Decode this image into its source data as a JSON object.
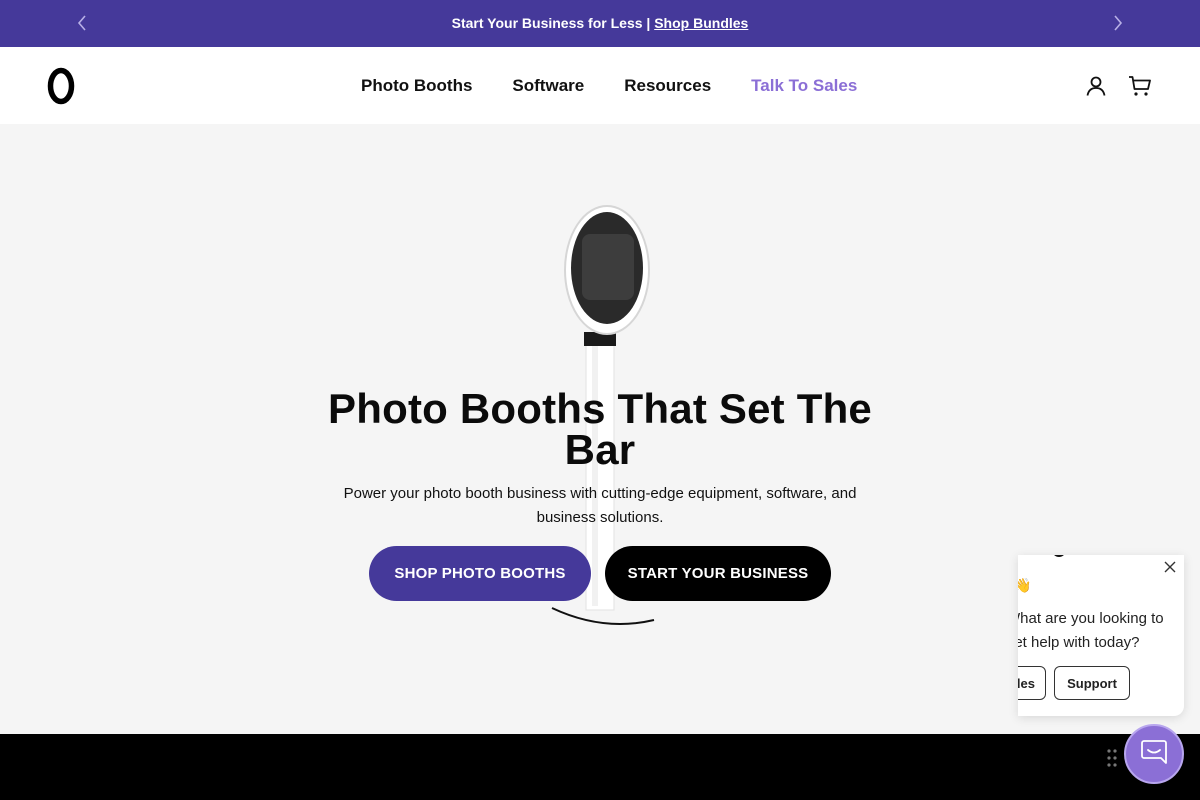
{
  "announcement": {
    "text": "Start Your Business for Less |",
    "link": "Shop Bundles"
  },
  "header": {
    "logo_alt": "0",
    "nav": [
      {
        "label": "Photo Booths"
      },
      {
        "label": "Software"
      },
      {
        "label": "Resources"
      },
      {
        "label": "Talk To Sales"
      }
    ]
  },
  "hero": {
    "title": "Photo Booths That Set The Bar",
    "subtitle": "Power your photo booth business with cutting-edge equipment, software, and business solutions.",
    "primary_button": "SHOP PHOTO BOOTHS",
    "secondary_button": "START YOUR BUSINESS"
  },
  "chat": {
    "emoji": "👋",
    "message": "What are you looking to get help with today?",
    "options": [
      {
        "label": "Sales"
      },
      {
        "label": "Support"
      }
    ]
  },
  "colors": {
    "brand": "#45399a",
    "accent": "#8b6fd6",
    "hero_bg": "#f5f5f5",
    "footer": "#000000"
  },
  "icons": [
    "chevron-left-icon",
    "chevron-right-icon",
    "account-icon",
    "cart-icon",
    "close-icon",
    "chat-icon",
    "drag-handle-icon"
  ]
}
